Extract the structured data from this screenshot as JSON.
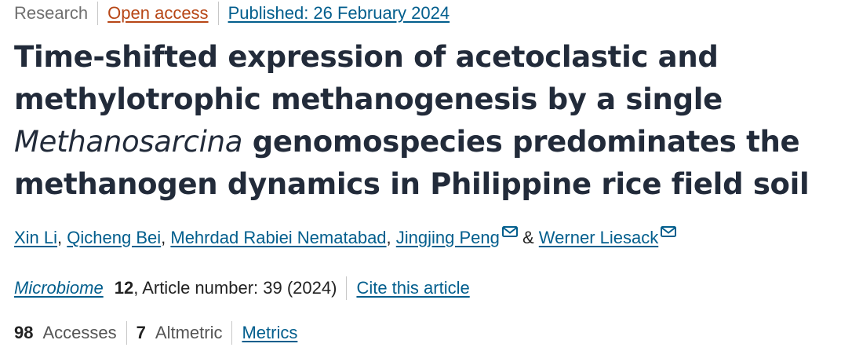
{
  "header": {
    "article_type": "Research",
    "access": "Open access",
    "published": "Published: 26 February 2024"
  },
  "title": {
    "line1": "Time-shifted expression of acetoclastic and",
    "line2": "methylotrophic methanogenesis by a single",
    "line3_italic": "Methanosarcina",
    "line3_rest": " genomospecies predominates the",
    "line4": "methanogen dynamics in Philippine rice field soil"
  },
  "authors": [
    {
      "name": "Xin Li"
    },
    {
      "name": "Qicheng Bei"
    },
    {
      "name": "Mehrdad Rabiei Nematabad"
    },
    {
      "name": "Jingjing Peng"
    },
    {
      "name": "Werner Liesack"
    }
  ],
  "author_separators": {
    "comma": ", ",
    "amp": " & "
  },
  "journal": {
    "name": "Microbiome",
    "volume": "12",
    "article_number": ", Article number: 39 (2024)",
    "cite": "Cite this article"
  },
  "metrics": {
    "accesses_count": "98",
    "accesses_label": "Accesses",
    "altmetric_count": "7",
    "altmetric_label": "Altmetric",
    "metrics_link": "Metrics"
  },
  "colors": {
    "link": "#025e8d",
    "open_access": "#b74616",
    "title": "#222b3a"
  },
  "icons": {
    "email": "mail-icon"
  }
}
